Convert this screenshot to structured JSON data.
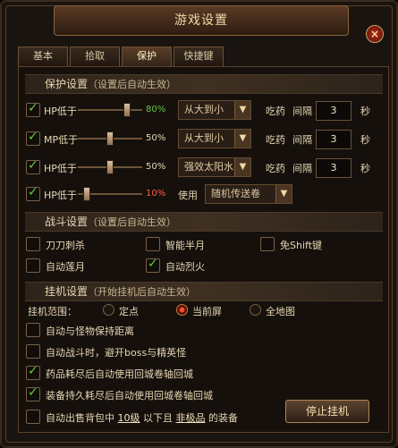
{
  "window": {
    "title": "游戏设置",
    "close_label": "×"
  },
  "tabs": [
    {
      "label": "基本"
    },
    {
      "label": "拾取"
    },
    {
      "label": "保护"
    },
    {
      "label": "快捷键"
    }
  ],
  "protection": {
    "section_title": "保护设置",
    "section_note": "（设置后自动生效）",
    "rows": [
      {
        "label": "HP低于",
        "percent": "80%",
        "value": 0.8,
        "dropdown": "从大到小",
        "action": "吃药",
        "interval_label": "间隔",
        "interval": "3",
        "unit": "秒"
      },
      {
        "label": "MP低于",
        "percent": "50%",
        "value": 0.5,
        "dropdown": "从大到小",
        "action": "吃药",
        "interval_label": "间隔",
        "interval": "3",
        "unit": "秒"
      },
      {
        "label": "HP低于",
        "percent": "50%",
        "value": 0.5,
        "dropdown": "强效太阳水",
        "action": "吃药",
        "interval_label": "间隔",
        "interval": "3",
        "unit": "秒"
      },
      {
        "label": "HP低于",
        "percent": "10%",
        "value": 0.1,
        "use_label": "使用",
        "dropdown": "随机传送卷"
      }
    ]
  },
  "battle": {
    "section_title": "战斗设置",
    "section_note": "（设置后自动生效）",
    "options": [
      {
        "label": "刀刀刺杀",
        "checked": false
      },
      {
        "label": "智能半月",
        "checked": false
      },
      {
        "label": "免Shift键",
        "checked": false
      },
      {
        "label": "自动莲月",
        "checked": false
      },
      {
        "label": "自动烈火",
        "checked": true
      }
    ]
  },
  "hangup": {
    "section_title": "挂机设置",
    "section_note": "（开始挂机后自动生效）",
    "range_label": "挂机范围：",
    "range_options": [
      {
        "label": "定点"
      },
      {
        "label": "当前屏"
      },
      {
        "label": "全地图"
      }
    ],
    "options": [
      {
        "label": "自动与怪物保持距离",
        "checked": false
      },
      {
        "label": "自动战斗时，避开boss与精英怪",
        "checked": false
      },
      {
        "label": "药品耗尽后自动使用回城卷轴回城",
        "checked": true
      },
      {
        "label": "装备持久耗尽后自动使用回城卷轴回城",
        "checked": true
      }
    ],
    "sell": {
      "prefix": "自动出售背包中",
      "level": "10级",
      "mid": "以下且",
      "quality": "非极品",
      "suffix": "的装备"
    },
    "stop_button": "停止挂机"
  },
  "colors": {
    "accent": "#ff5a46",
    "success": "#65c447",
    "text": "#e6d6b3"
  }
}
